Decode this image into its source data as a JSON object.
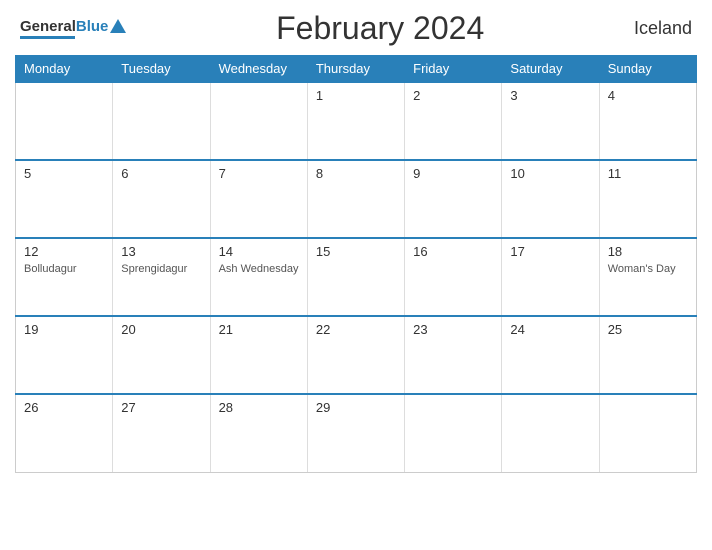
{
  "header": {
    "title": "February 2024",
    "country": "Iceland",
    "logo_general": "General",
    "logo_blue": "Blue"
  },
  "weekdays": [
    "Monday",
    "Tuesday",
    "Wednesday",
    "Thursday",
    "Friday",
    "Saturday",
    "Sunday"
  ],
  "weeks": [
    [
      {
        "day": "",
        "event": "",
        "empty": true
      },
      {
        "day": "",
        "event": "",
        "empty": true
      },
      {
        "day": "",
        "event": "",
        "empty": true
      },
      {
        "day": "1",
        "event": ""
      },
      {
        "day": "2",
        "event": ""
      },
      {
        "day": "3",
        "event": ""
      },
      {
        "day": "4",
        "event": ""
      }
    ],
    [
      {
        "day": "5",
        "event": ""
      },
      {
        "day": "6",
        "event": ""
      },
      {
        "day": "7",
        "event": ""
      },
      {
        "day": "8",
        "event": ""
      },
      {
        "day": "9",
        "event": ""
      },
      {
        "day": "10",
        "event": ""
      },
      {
        "day": "11",
        "event": ""
      }
    ],
    [
      {
        "day": "12",
        "event": "Bolludagur"
      },
      {
        "day": "13",
        "event": "Sprengidagur"
      },
      {
        "day": "14",
        "event": "Ash Wednesday"
      },
      {
        "day": "15",
        "event": ""
      },
      {
        "day": "16",
        "event": ""
      },
      {
        "day": "17",
        "event": ""
      },
      {
        "day": "18",
        "event": "Woman's Day"
      }
    ],
    [
      {
        "day": "19",
        "event": ""
      },
      {
        "day": "20",
        "event": ""
      },
      {
        "day": "21",
        "event": ""
      },
      {
        "day": "22",
        "event": ""
      },
      {
        "day": "23",
        "event": ""
      },
      {
        "day": "24",
        "event": ""
      },
      {
        "day": "25",
        "event": ""
      }
    ],
    [
      {
        "day": "26",
        "event": ""
      },
      {
        "day": "27",
        "event": ""
      },
      {
        "day": "28",
        "event": ""
      },
      {
        "day": "29",
        "event": ""
      },
      {
        "day": "",
        "event": "",
        "empty": true
      },
      {
        "day": "",
        "event": "",
        "empty": true
      },
      {
        "day": "",
        "event": "",
        "empty": true
      }
    ]
  ]
}
